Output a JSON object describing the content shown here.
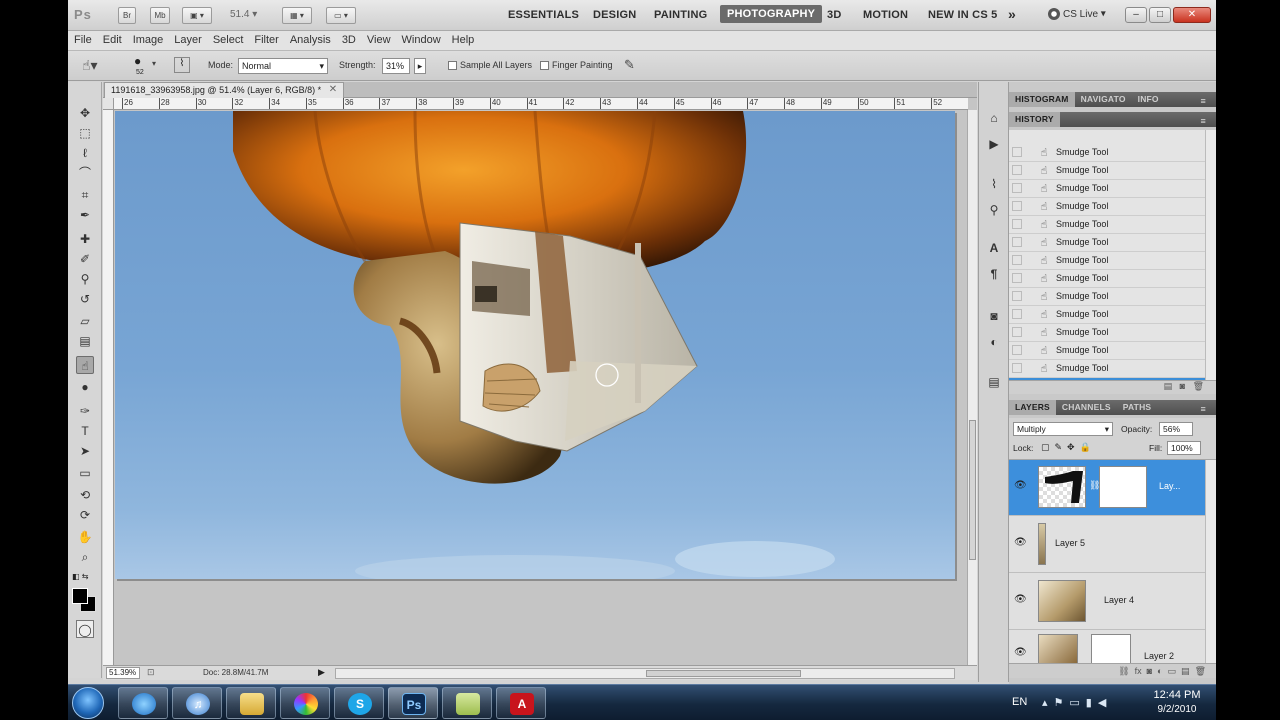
{
  "appbar": {
    "logo": "Ps",
    "btn_br": "Br",
    "btn_mb": "Mb",
    "zoom": "51.4",
    "workspaces": [
      "ESSENTIALS",
      "DESIGN",
      "PAINTING",
      "PHOTOGRAPHY",
      "3D",
      "MOTION",
      "NEW IN CS 5"
    ],
    "active_workspace": "PHOTOGRAPHY",
    "more": "»",
    "cs_live": "CS Live",
    "window_buttons": [
      "–",
      "□",
      "✕"
    ]
  },
  "menubar": [
    "File",
    "Edit",
    "Image",
    "Layer",
    "Select",
    "Filter",
    "Analysis",
    "3D",
    "View",
    "Window",
    "Help"
  ],
  "options": {
    "mode_label": "Mode:",
    "mode_value": "Normal",
    "brush_size": "52",
    "strength_label": "Strength:",
    "strength_value": "31%",
    "sample_all_layers": "Sample All Layers",
    "finger_painting": "Finger Painting"
  },
  "document": {
    "tab_title": "1191618_33963958.jpg @ 51.4% (Layer 6, RGB/8) *",
    "ruler_ticks": [
      "26",
      "28",
      "30",
      "32",
      "34",
      "35",
      "36",
      "37",
      "38",
      "39",
      "40",
      "41",
      "42",
      "43",
      "44",
      "45",
      "46",
      "47",
      "48",
      "49",
      "50",
      "51",
      "52"
    ],
    "zoom_status": "51.39%",
    "doc_info": "Doc: 28.8M/41.7M"
  },
  "panels": {
    "top_tabs": [
      "HISTOGRAM",
      "NAVIGATO",
      "INFO"
    ],
    "history_tab": "HISTORY",
    "history_items": [
      "Smudge Tool",
      "Smudge Tool",
      "Smudge Tool",
      "Smudge Tool",
      "Smudge Tool",
      "Smudge Tool",
      "Smudge Tool",
      "Smudge Tool",
      "Smudge Tool",
      "Smudge Tool",
      "Smudge Tool",
      "Smudge Tool",
      "Smudge Tool",
      "Smudge Tool"
    ],
    "layer_tabs": [
      "LAYERS",
      "CHANNELS",
      "PATHS"
    ],
    "blend_mode": "Multiply",
    "opacity_label": "Opacity:",
    "opacity_value": "56%",
    "lock_label": "Lock:",
    "fill_label": "Fill:",
    "fill_value": "100%",
    "layers": [
      "Lay...",
      "Layer 5",
      "Layer 4",
      "Layer 2"
    ]
  },
  "taskbar": {
    "apps": [
      "ie-app",
      "itunes-app",
      "explorer-app",
      "picasa-app",
      "skype-app",
      "photoshop-app",
      "notes-app",
      "acrobat-app"
    ],
    "ps_label": "Ps",
    "language": "EN",
    "time": "12:44 PM",
    "date": "9/2/2010"
  }
}
